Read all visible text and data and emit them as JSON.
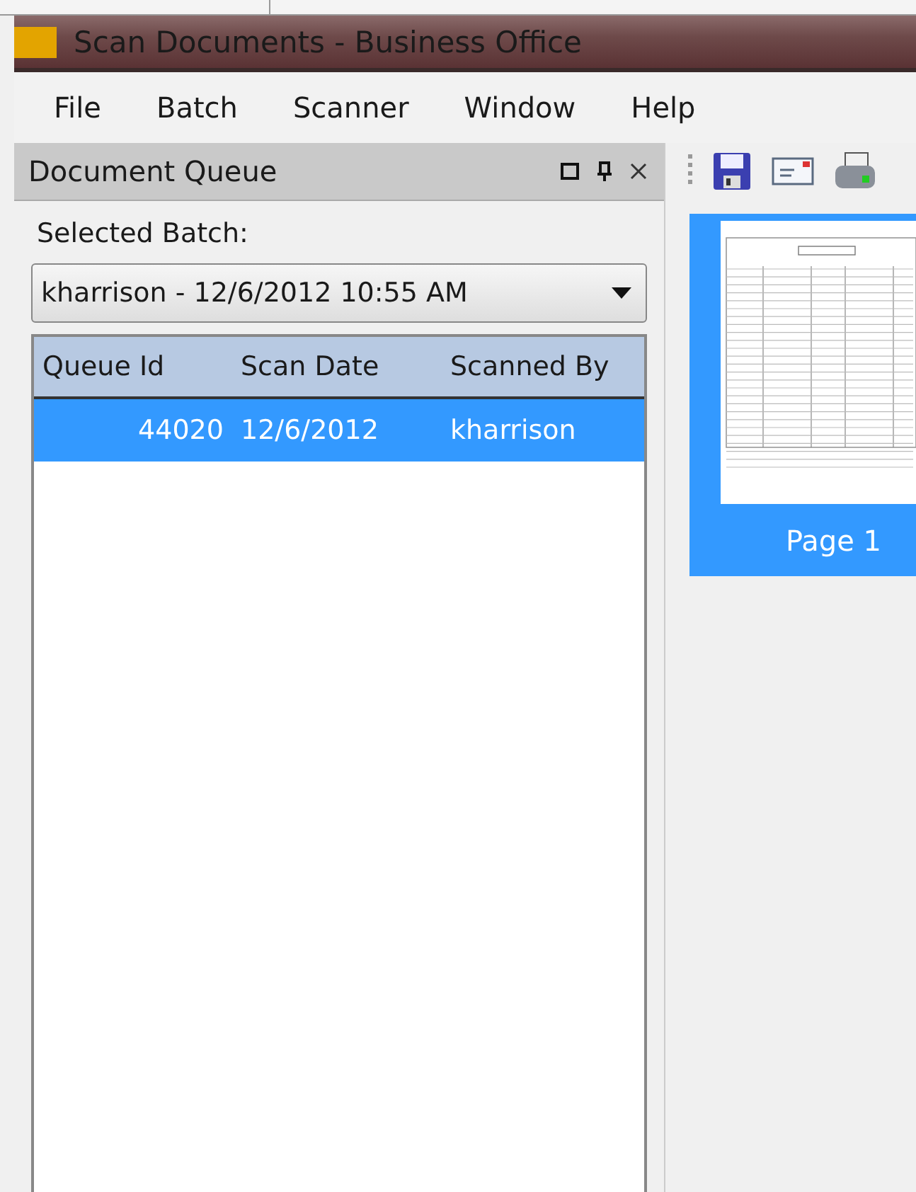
{
  "window": {
    "title": "Scan Documents - Business Office"
  },
  "menu": [
    {
      "label": "File"
    },
    {
      "label": "Batch"
    },
    {
      "label": "Scanner"
    },
    {
      "label": "Window"
    },
    {
      "label": "Help"
    }
  ],
  "queue_panel": {
    "title": "Document Queue",
    "batch_label": "Selected Batch:",
    "batch_value": "kharrison - 12/6/2012 10:55 AM",
    "columns": [
      "Queue Id",
      "Scan Date",
      "Scanned By"
    ],
    "rows": [
      {
        "cells": [
          "44020",
          "12/6/2012",
          "kharrison"
        ],
        "selected": true
      }
    ]
  },
  "pages": [
    {
      "label": "Page 1",
      "selected": true
    }
  ]
}
